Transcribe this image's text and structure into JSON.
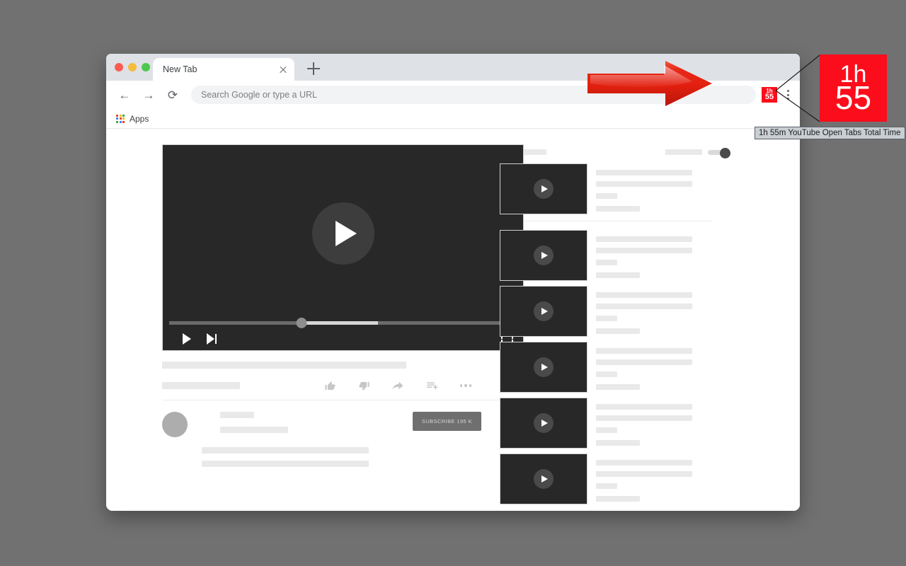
{
  "browser": {
    "tab": {
      "title": "New Tab",
      "close_icon": "close-icon"
    },
    "new_tab_icon": "plus-icon",
    "traffic_lights": [
      "close-red",
      "minimize-yellow",
      "maximize-green"
    ],
    "nav": {
      "back_icon": "arrow-left-icon",
      "forward_icon": "arrow-right-icon",
      "reload_icon": "reload-icon",
      "back_glyph": "←",
      "forward_glyph": "→",
      "reload_glyph": "⟳"
    },
    "omnibox": {
      "value": "",
      "placeholder": "Search Google or type a URL"
    },
    "extension_badge": {
      "line1": "1h",
      "line2": "55",
      "color": "#fc0d1b"
    },
    "menu_icon": "three-dots-vertical-icon",
    "bookmarks": {
      "apps_label": "Apps",
      "apps_icon": "apps-grid-icon"
    }
  },
  "callout": {
    "magnified_badge": {
      "line1": "1h",
      "line2": "55",
      "color": "#fc0d1b"
    },
    "tooltip": "1h 55m YouTube Open Tabs Total Time",
    "arrow_icon": "red-arrow-right-icon",
    "arrow_color": "#e8261a"
  },
  "player": {
    "play_icon": "play-circle-icon",
    "controls": {
      "play_icon": "play-icon",
      "next_icon": "next-track-icon",
      "fullscreen_icon": "fullscreen-icon"
    },
    "progress": {
      "played_percent": 38,
      "buffered_percent": 60
    }
  },
  "video_meta": {
    "actions": [
      {
        "name": "like-button",
        "icon": "thumbs-up-icon"
      },
      {
        "name": "dislike-button",
        "icon": "thumbs-down-icon"
      },
      {
        "name": "share-button",
        "icon": "share-arrow-icon"
      },
      {
        "name": "save-button",
        "icon": "add-to-playlist-icon"
      },
      {
        "name": "more-actions-button",
        "icon": "three-dots-horizontal-icon"
      }
    ],
    "subscribe_label": "SUBSCRIBE  195 K",
    "avatar_icon": "channel-avatar"
  },
  "sidebar": {
    "autoplay": {
      "toggle_state": "on"
    },
    "items": [
      {
        "thumb_icon": "play-circle-icon"
      },
      {
        "thumb_icon": "play-circle-icon"
      },
      {
        "thumb_icon": "play-circle-icon"
      },
      {
        "thumb_icon": "play-circle-icon"
      },
      {
        "thumb_icon": "play-circle-icon"
      },
      {
        "thumb_icon": "play-circle-icon"
      }
    ]
  }
}
